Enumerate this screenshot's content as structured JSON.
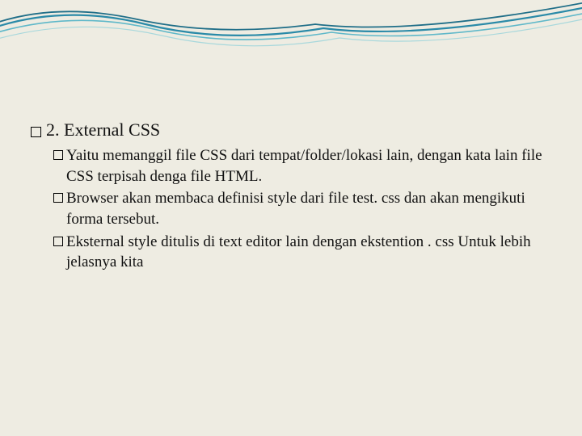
{
  "slide": {
    "heading": "2. External CSS",
    "items": [
      "Yaitu memanggil file CSS dari tempat/folder/lokasi lain, dengan kata lain file CSS terpisah denga file HTML.",
      "Browser akan membaca definisi style dari file test. css dan akan mengikuti forma tersebut.",
      "Eksternal style ditulis di text editor lain dengan ekstention . css Untuk lebih jelasnya kita"
    ]
  }
}
